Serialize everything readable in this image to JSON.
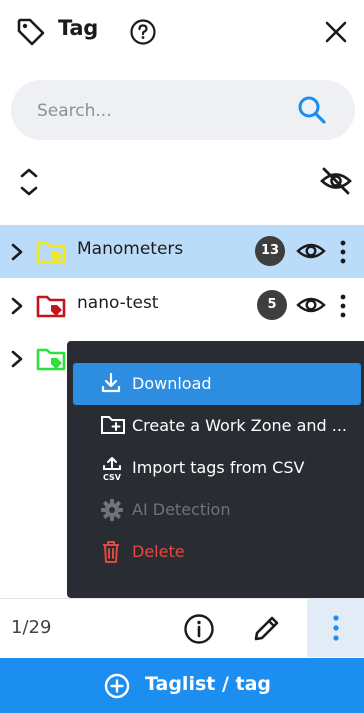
{
  "header": {
    "title": "Tag"
  },
  "search": {
    "placeholder": "Search..."
  },
  "tags": [
    {
      "label": "Manometers",
      "count": "13",
      "color": "#f5f23a"
    },
    {
      "label": "nano-test",
      "count": "5",
      "color": "#c4141c"
    },
    {
      "label": "",
      "count": "",
      "color": "#2ee03a"
    }
  ],
  "context_menu": {
    "items": [
      {
        "label": "Download",
        "icon": "download-icon"
      },
      {
        "label": "Create a Work Zone and ...",
        "icon": "folder-plus-icon"
      },
      {
        "label": "Import tags from CSV",
        "icon": "csv-upload-icon"
      },
      {
        "label": "AI Detection",
        "icon": "gear-icon"
      },
      {
        "label": "Delete",
        "icon": "trash-icon"
      }
    ]
  },
  "footer": {
    "page_count": "1/29"
  },
  "bottom_button": {
    "label": "Taglist / tag"
  },
  "colors": {
    "accent": "#1b8ef0",
    "selected_row": "#bbdcf8",
    "menu_bg": "#292c33",
    "danger": "#e24a40"
  }
}
